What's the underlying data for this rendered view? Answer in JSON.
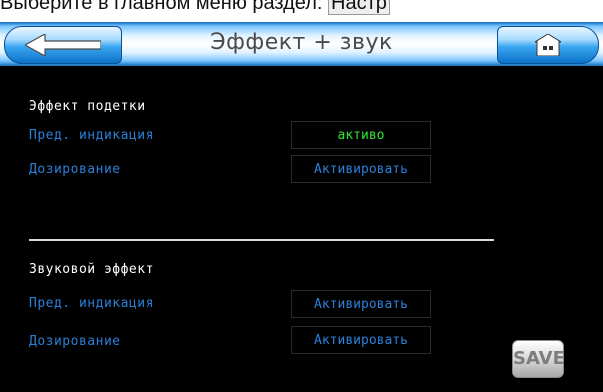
{
  "doc_caption": {
    "text": "Выберите в главном меню раздел: ",
    "boxed": "Настр"
  },
  "header": {
    "title": "Эффект + звук",
    "back_icon": "arrow-left-icon",
    "home_icon": "home-icon"
  },
  "section1": {
    "label": "Эффект подетки",
    "rows": [
      {
        "label": "Пред. индикация",
        "value": "активо",
        "active": true
      },
      {
        "label": "Дозирование",
        "value": "Активировать",
        "active": false
      }
    ]
  },
  "section2": {
    "label": "Звуковой эффект",
    "rows": [
      {
        "label": "Пред. индикация",
        "value": "Активировать",
        "active": false
      },
      {
        "label": "Дозирование",
        "value": "Активировать",
        "active": false
      }
    ]
  },
  "save": {
    "label": "SAVE"
  },
  "colors": {
    "background": "#000000",
    "label_blue": "#2b7fd6",
    "active_green": "#33e633",
    "header_blue": "#0e6fc0"
  }
}
